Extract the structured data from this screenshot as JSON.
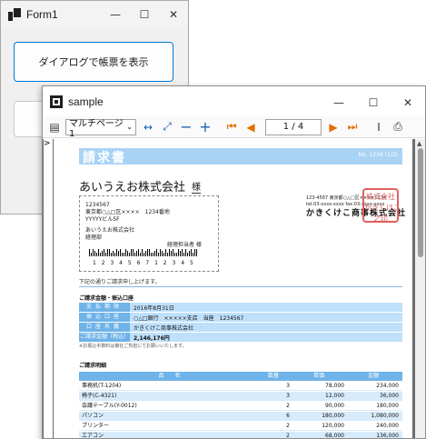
{
  "form1": {
    "title": "Form1",
    "show_dialog_button": "ダイアログで帳票を表示"
  },
  "sample": {
    "title": "sample",
    "toolbar": {
      "page_mode": "マルチページ1",
      "page_indicator": "1 / 4",
      "icons": [
        "thumbnail-icon",
        "fit-width-icon",
        "fit-page-icon",
        "zoom-out-icon",
        "zoom-in-icon",
        "first-page-icon",
        "prev-page-icon",
        "next-page-icon",
        "last-page-icon",
        "cursor-icon",
        "print-icon"
      ]
    },
    "left_marker": ">"
  },
  "report": {
    "title": "請求書",
    "number": "No. 1234 (1/2)",
    "customer": "あいうえお株式会社",
    "honorific": "様",
    "address": {
      "zip": "1234567",
      "line1": "東京都○△□区××××　1234番地",
      "line2": "YYYYYビル5F",
      "company": "あいうえお株式会社",
      "dept": "経理部",
      "person": "経理担当者 様",
      "barcode_digits": "1 2 3 4 5 6 7 1 2 3 4 5"
    },
    "sender": {
      "small": "123-4567 東京都○△□区××××1234\ntel:03-xxxx-xxxx fax:03-xxxx-xxxx",
      "name": "かきくけこ商事株式会社",
      "stamp": "株式会社\nかきくけこ\n之印"
    },
    "intro": "下記の通りご請求申し上げます。",
    "section_billing": "ご請求金額・振込口座",
    "billing_rows": [
      {
        "label": "支払期限",
        "value": "2016年8月31日"
      },
      {
        "label": "振込口座",
        "value": "○△□銀行　×××××支店　当座　1234567"
      },
      {
        "label": "口座名義",
        "value": "かきくけこ商事株式会社"
      },
      {
        "label": "ご請求金額（税込）",
        "value": "2,146,176円"
      }
    ],
    "note": "※お振込手数料は御社ご負担にてお願いいたします。",
    "section_detail": "ご請求明細",
    "table_headers": [
      "品　　名",
      "数量",
      "単価",
      "金額"
    ],
    "items": [
      {
        "name": "事務机(T-1204)",
        "qty": "3",
        "price": "78,000",
        "amount": "234,000"
      },
      {
        "name": "椅子(C-4321)",
        "qty": "3",
        "price": "12,000",
        "amount": "36,000"
      },
      {
        "name": "会議テーブル(Y-0012)",
        "qty": "2",
        "price": "90,000",
        "amount": "180,000"
      },
      {
        "name": "パソコン",
        "qty": "6",
        "price": "180,000",
        "amount": "1,080,000"
      },
      {
        "name": "プリンター",
        "qty": "2",
        "price": "120,000",
        "amount": "240,000"
      },
      {
        "name": "エアコン",
        "qty": "2",
        "price": "68,000",
        "amount": "136,000"
      }
    ]
  }
}
